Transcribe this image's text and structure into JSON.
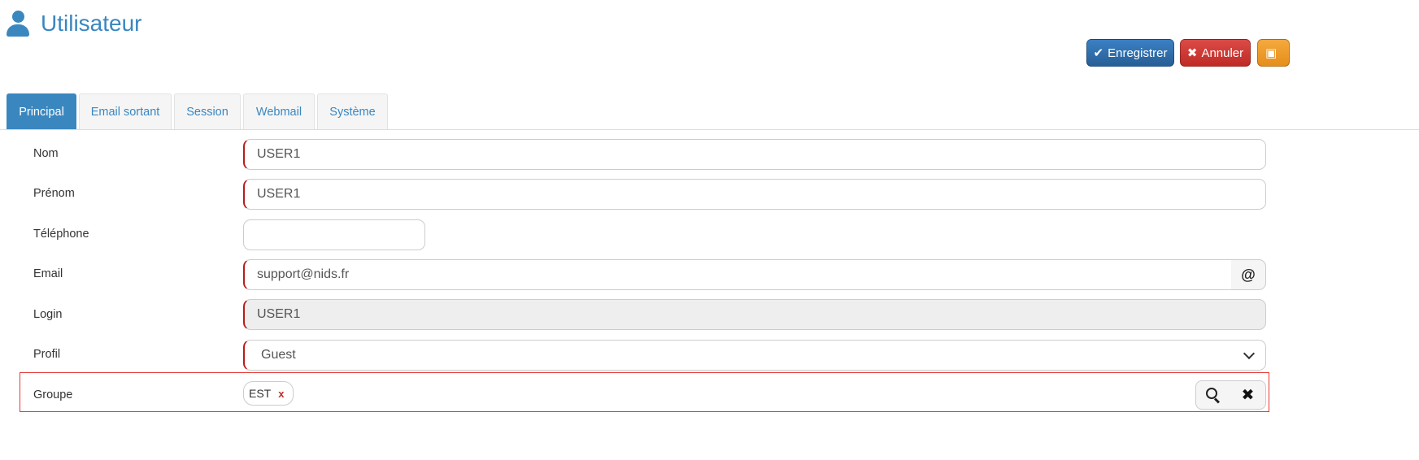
{
  "header": {
    "title": "Utilisateur",
    "icon": "user-icon"
  },
  "toolbar": {
    "save": {
      "label": "Enregistrer",
      "icon": "check-icon",
      "glyph": "✔",
      "color": "#2e6da4"
    },
    "cancel": {
      "label": "Annuler",
      "icon": "close-icon",
      "glyph": "✖",
      "color": "#d43f3a"
    },
    "extra": {
      "icon": "save-icon",
      "glyph": "💾",
      "color": "#f0ad4e"
    }
  },
  "tabs": [
    {
      "label": "Principal",
      "active": true
    },
    {
      "label": "Email sortant",
      "active": false
    },
    {
      "label": "Session",
      "active": false
    },
    {
      "label": "Webmail",
      "active": false
    },
    {
      "label": "Système",
      "active": false
    }
  ],
  "form": {
    "nom": {
      "label": "Nom",
      "value": "USER1"
    },
    "prenom": {
      "label": "Prénom",
      "value": "USER1"
    },
    "telephone": {
      "label": "Téléphone",
      "value": ""
    },
    "email": {
      "label": "Email",
      "value": "support@nids.fr",
      "addon": "@"
    },
    "login": {
      "label": "Login",
      "value": "USER1"
    },
    "profil": {
      "label": "Profil",
      "value": "Guest"
    },
    "groupe": {
      "label": "Groupe",
      "tags": [
        {
          "label": "EST",
          "remove": "x"
        }
      ]
    }
  },
  "colors": {
    "accent": "#3a87c0",
    "required": "#b71c1c",
    "highlight": "#e53935"
  }
}
